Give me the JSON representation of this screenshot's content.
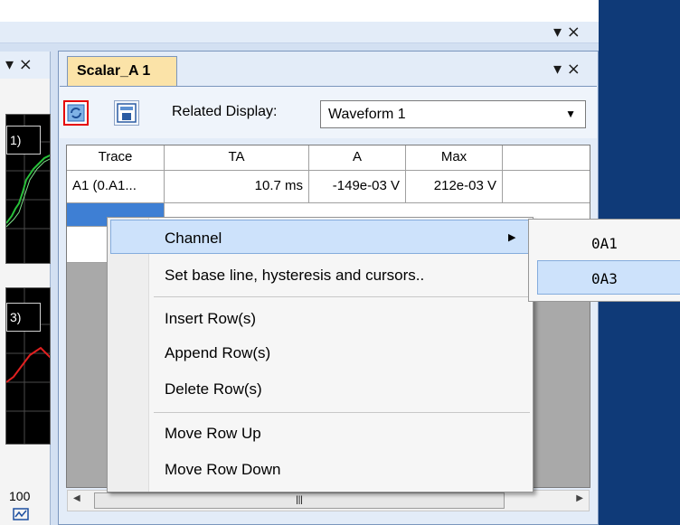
{
  "window": {
    "close_glyph": "▾ ×"
  },
  "left_panel": {
    "close_glyph": "▾ ×",
    "trace1_label": "1)",
    "trace2_label": "3)",
    "value": "100",
    "icon": "fit-icon"
  },
  "panel": {
    "tab_title": "Scalar_A 1",
    "close_glyph": "▾ ×",
    "toolbar": {
      "related_label": "Related Display:",
      "related_value": "Waveform 1"
    }
  },
  "table": {
    "headers": [
      "Trace",
      "TA",
      "A",
      "Max"
    ],
    "rows": [
      [
        "A1 (0.A1...",
        "10.7 ms",
        "-149e-03 V",
        "212e-03 V"
      ]
    ]
  },
  "context_menu": {
    "items": [
      "Channel",
      "Set base line, hysteresis and cursors..",
      "Insert Row(s)",
      "Append Row(s)",
      "Delete Row(s)",
      "Move Row Up",
      "Move Row Down"
    ],
    "submenu": [
      "0A1",
      "0A3"
    ]
  },
  "colors": {
    "selection": "#3e7fd4",
    "menu_highlight": "#cde2fb",
    "tab": "#fbe3a8",
    "refresh_border": "#e60000"
  }
}
